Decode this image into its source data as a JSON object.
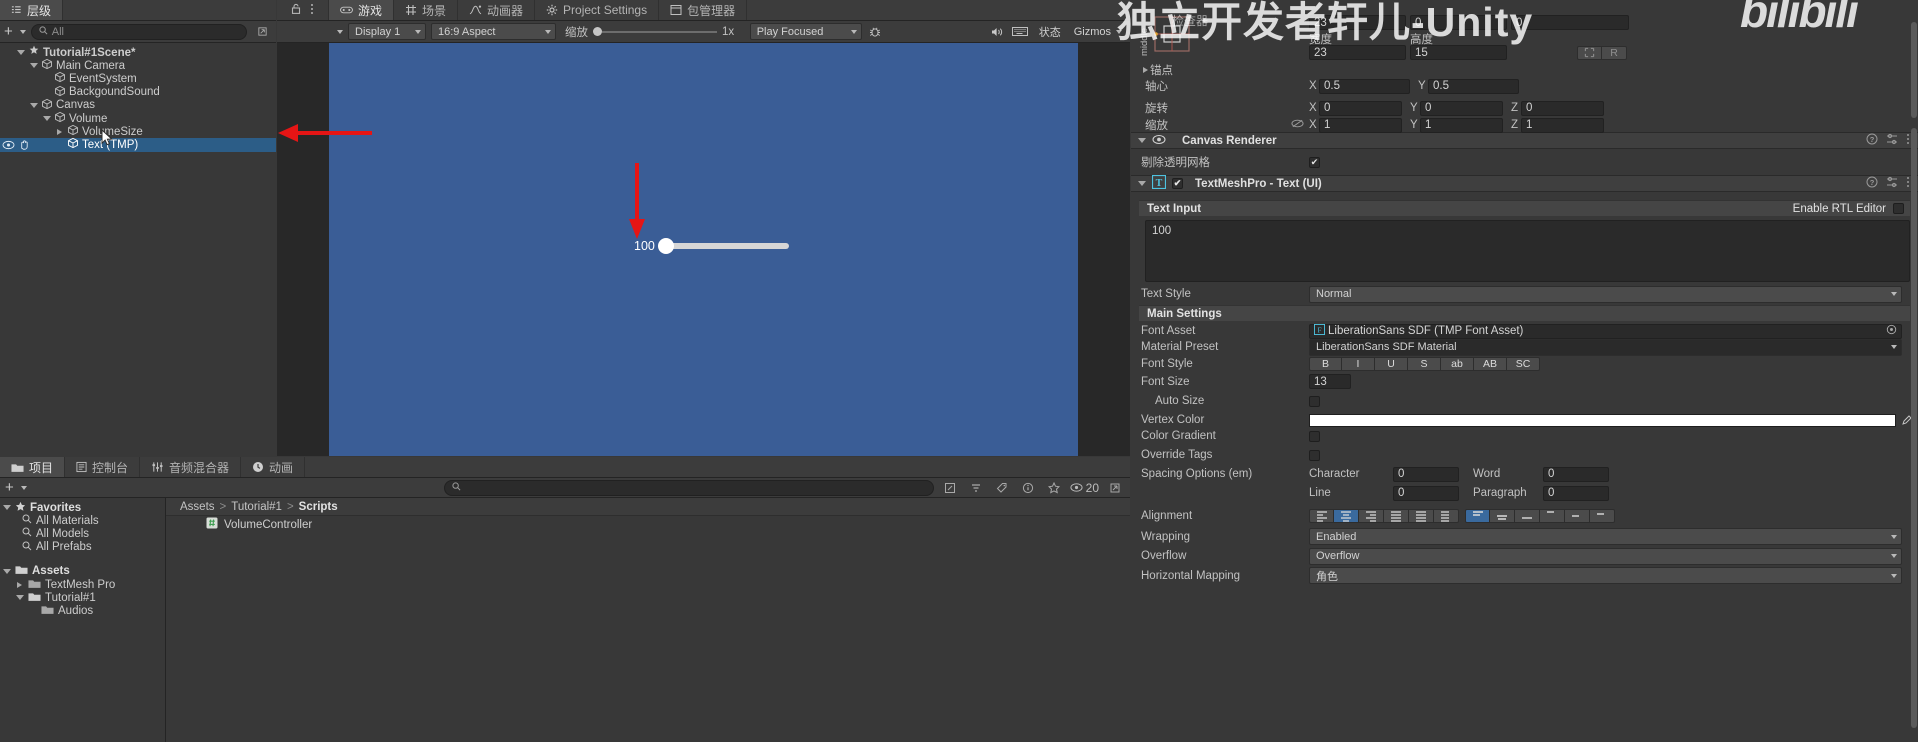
{
  "hierarchy": {
    "tab_label": "层级",
    "add_label": "+",
    "search_placeholder": "All",
    "items": [
      {
        "label": "Tutorial#1Scene*",
        "depth": 1,
        "type": "scene",
        "expanded": true,
        "selected": false,
        "bold": true
      },
      {
        "label": "Main Camera",
        "depth": 2,
        "type": "go",
        "expanded": true,
        "selected": false
      },
      {
        "label": "EventSystem",
        "depth": 3,
        "type": "go",
        "expanded": null,
        "selected": false
      },
      {
        "label": "BackgoundSound",
        "depth": 3,
        "type": "go",
        "expanded": null,
        "selected": false
      },
      {
        "label": "Canvas",
        "depth": 2,
        "type": "go",
        "expanded": true,
        "selected": false
      },
      {
        "label": "Volume",
        "depth": 3,
        "type": "go",
        "expanded": true,
        "selected": false
      },
      {
        "label": "VolumeSize",
        "depth": 4,
        "type": "go",
        "expanded": false,
        "selected": false
      },
      {
        "label": "Text (TMP)",
        "depth": 4,
        "type": "go",
        "expanded": null,
        "selected": true
      }
    ]
  },
  "editor_tabs": [
    {
      "label": "游戏",
      "icon": "gamepad-icon",
      "active": true
    },
    {
      "label": "场景",
      "icon": "grid-icon",
      "active": false
    },
    {
      "label": "动画器",
      "icon": "animator-icon",
      "active": false
    },
    {
      "label": "Project Settings",
      "icon": "gear-icon",
      "active": false
    },
    {
      "label": "包管理器",
      "icon": "package-icon",
      "active": false
    }
  ],
  "gameview": {
    "display": "Display 1",
    "aspect": "16:9 Aspect",
    "scale_label": "缩放",
    "scale_value": "1x",
    "play_mode": "Play Focused",
    "stats_label": "状态",
    "gizmos_label": "Gizmos",
    "slider_value": "100",
    "background_color": "#3a5d96"
  },
  "project": {
    "tabs": [
      {
        "label": "项目",
        "icon": "folder-icon",
        "active": true
      },
      {
        "label": "控制台",
        "icon": "console-icon",
        "active": false
      },
      {
        "label": "音频混合器",
        "icon": "mixer-icon",
        "active": false
      },
      {
        "label": "动画",
        "icon": "clock-icon",
        "active": false
      }
    ],
    "add_label": "+",
    "search_placeholder": "",
    "item_count": "20",
    "breadcrumb": [
      "Assets",
      "Tutorial#1",
      "Scripts"
    ],
    "favorites": {
      "label": "Favorites",
      "items": [
        "All Materials",
        "All Models",
        "All Prefabs"
      ]
    },
    "assets_tree": [
      {
        "label": "Assets",
        "depth": 0,
        "type": "folder-open",
        "expanded": true,
        "bold": true
      },
      {
        "label": "TextMesh Pro",
        "depth": 1,
        "type": "folder",
        "expanded": false
      },
      {
        "label": "Tutorial#1",
        "depth": 1,
        "type": "folder-open",
        "expanded": true
      },
      {
        "label": "Audios",
        "depth": 2,
        "type": "folder",
        "expanded": null
      }
    ],
    "files": [
      {
        "label": "VolumeController",
        "icon": "cs-script-icon"
      }
    ]
  },
  "inspector": {
    "title": "检查器",
    "rect_transform": {
      "anchor_preset_label": "middle",
      "pos_z_label": "",
      "top_values": [
        "23",
        "0",
        "0"
      ],
      "width_label": "宽度",
      "height_label": "高度",
      "width": "23",
      "height": "15",
      "blueprint_label": "",
      "raw_label": "R",
      "anchors_label": "锚点",
      "pivot_label": "轴心",
      "pivot_x": "0.5",
      "pivot_y": "0.5",
      "rotation_label": "旋转",
      "rot_x": "0",
      "rot_y": "0",
      "rot_z": "0",
      "scale_label": "缩放",
      "scale_x": "1",
      "scale_y": "1",
      "scale_z": "1",
      "axis_x": "X",
      "axis_y": "Y",
      "axis_z": "Z"
    },
    "canvas_renderer": {
      "title": "Canvas Renderer",
      "cull_label": "剔除透明网格",
      "cull_checked": true
    },
    "tmp": {
      "title": "TextMeshPro - Text (UI)",
      "enabled": true,
      "text_input_label": "Text Input",
      "rtl_label": "Enable RTL Editor",
      "text_value": "100",
      "text_style_label": "Text Style",
      "text_style_value": "Normal",
      "main_settings_label": "Main Settings",
      "font_asset_label": "Font Asset",
      "font_asset_value": "LiberationSans SDF (TMP Font Asset)",
      "material_preset_label": "Material Preset",
      "material_preset_value": "LiberationSans SDF Material",
      "font_style_label": "Font Style",
      "font_style_buttons": [
        "B",
        "I",
        "U",
        "S",
        "ab",
        "AB",
        "SC"
      ],
      "font_size_label": "Font Size",
      "font_size_value": "13",
      "auto_size_label": "Auto Size",
      "auto_size_checked": false,
      "vertex_color_label": "Vertex Color",
      "vertex_color_value": "#FFFFFF",
      "color_gradient_label": "Color Gradient",
      "color_gradient_checked": false,
      "override_tags_label": "Override Tags",
      "override_tags_checked": false,
      "spacing_label": "Spacing Options (em)",
      "character_label": "Character",
      "character_value": "0",
      "word_label": "Word",
      "word_value": "0",
      "line_label": "Line",
      "line_value": "0",
      "paragraph_label": "Paragraph",
      "paragraph_value": "0",
      "alignment_label": "Alignment",
      "alignment_h_index": 1,
      "alignment_v_index": 0,
      "wrapping_label": "Wrapping",
      "wrapping_value": "Enabled",
      "overflow_label": "Overflow",
      "overflow_value": "Overflow",
      "horizontal_mapping_label": "Horizontal Mapping",
      "horizontal_mapping_value": "角色"
    }
  },
  "watermark": {
    "left_text": "独立开发者轩儿-Unity",
    "right_text": "bilibili"
  }
}
